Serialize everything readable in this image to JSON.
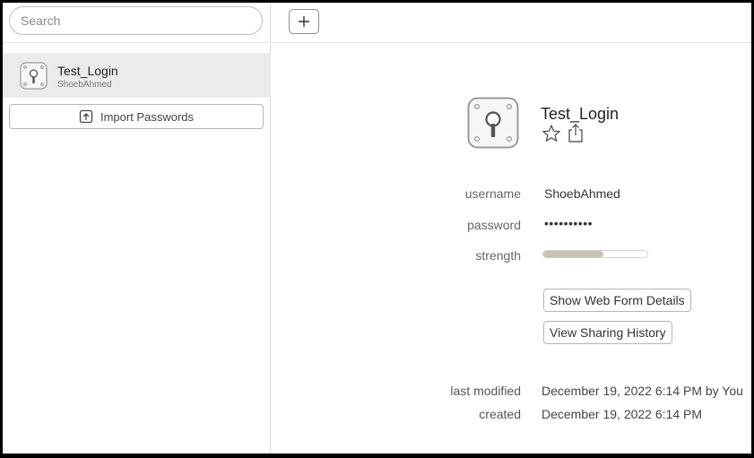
{
  "sidebar": {
    "search": {
      "placeholder": "Search",
      "value": ""
    },
    "items": [
      {
        "title": "Test_Login",
        "subtitle": "ShoebAhmed",
        "icon": "key-icon",
        "selected": true
      }
    ],
    "import_button": {
      "label": "Import Passwords",
      "icon": "import-icon"
    }
  },
  "toolbar": {
    "add_label": "+",
    "add_icon": "plus-icon"
  },
  "detail": {
    "title": "Test_Login",
    "icon": "key-icon",
    "actions": [
      {
        "icon": "star-icon"
      },
      {
        "icon": "share-icon"
      }
    ],
    "fields": {
      "username": {
        "label": "username",
        "value": "ShoebAhmed"
      },
      "password": {
        "label": "password",
        "value": "••••••••••"
      },
      "strength": {
        "label": "strength",
        "level": 0.58
      }
    },
    "buttons": {
      "web_form": "Show Web Form Details",
      "sharing_history": "View Sharing History"
    },
    "meta": {
      "modified": {
        "label": "last modified",
        "value": "December 19, 2022 6:14 PM by You"
      },
      "created": {
        "label": "created",
        "value": "December 19, 2022 6:14 PM"
      }
    }
  },
  "colors": {
    "background": "#ffffff",
    "frame": "#000000",
    "selected_row": "#ebebeb",
    "strength_fill": "#c9c2b0"
  }
}
